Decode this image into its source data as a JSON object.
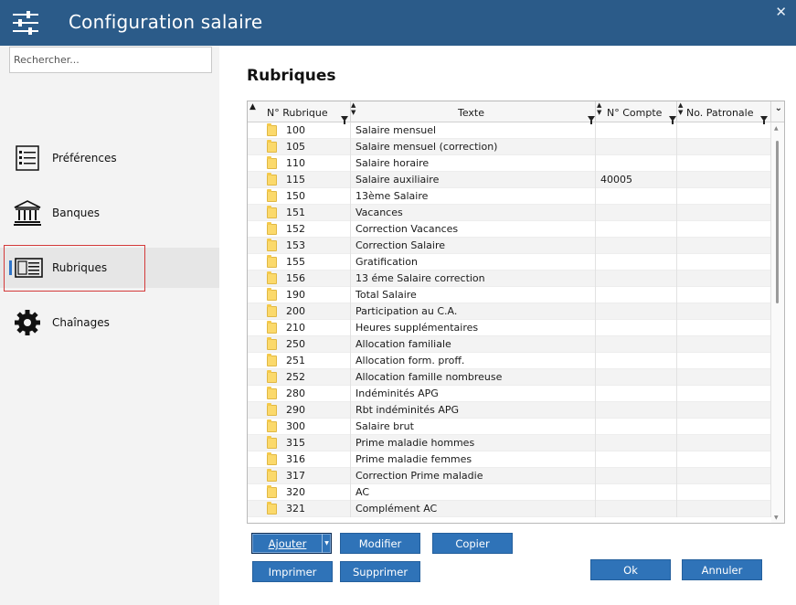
{
  "window": {
    "title": "Configuration salaire",
    "close_glyph": "✕"
  },
  "sidebar": {
    "search_placeholder": "Rechercher...",
    "items": [
      {
        "label": "Préférences",
        "icon": "preferences-list-icon"
      },
      {
        "label": "Banques",
        "icon": "bank-icon"
      },
      {
        "label": "Rubriques",
        "icon": "rubriques-panel-icon",
        "active": true
      },
      {
        "label": "Chaînages",
        "icon": "gear-icon"
      }
    ]
  },
  "main": {
    "title": "Rubriques",
    "columns": [
      "N° Rubrique",
      "Texte",
      "N° Compte",
      "No. Patronale"
    ],
    "rows": [
      {
        "num": "100",
        "texte": "Salaire mensuel",
        "compte": "",
        "patronale": ""
      },
      {
        "num": "105",
        "texte": "Salaire mensuel (correction)",
        "compte": "",
        "patronale": ""
      },
      {
        "num": "110",
        "texte": "Salaire horaire",
        "compte": "",
        "patronale": ""
      },
      {
        "num": "115",
        "texte": "Salaire auxiliaire",
        "compte": "40005",
        "patronale": ""
      },
      {
        "num": "150",
        "texte": "13ème Salaire",
        "compte": "",
        "patronale": ""
      },
      {
        "num": "151",
        "texte": "Vacances",
        "compte": "",
        "patronale": ""
      },
      {
        "num": "152",
        "texte": "Correction Vacances",
        "compte": "",
        "patronale": ""
      },
      {
        "num": "153",
        "texte": "Correction Salaire",
        "compte": "",
        "patronale": ""
      },
      {
        "num": "155",
        "texte": "Gratification",
        "compte": "",
        "patronale": ""
      },
      {
        "num": "156",
        "texte": "13 éme Salaire correction",
        "compte": "",
        "patronale": ""
      },
      {
        "num": "190",
        "texte": "Total Salaire",
        "compte": "",
        "patronale": ""
      },
      {
        "num": "200",
        "texte": "Participation au C.A.",
        "compte": "",
        "patronale": ""
      },
      {
        "num": "210",
        "texte": "Heures supplémentaires",
        "compte": "",
        "patronale": ""
      },
      {
        "num": "250",
        "texte": "Allocation familiale",
        "compte": "",
        "patronale": ""
      },
      {
        "num": "251",
        "texte": "Allocation form. proff.",
        "compte": "",
        "patronale": ""
      },
      {
        "num": "252",
        "texte": "Allocation famille nombreuse",
        "compte": "",
        "patronale": ""
      },
      {
        "num": "280",
        "texte": "Indéminités APG",
        "compte": "",
        "patronale": ""
      },
      {
        "num": "290",
        "texte": "Rbt indéminités APG",
        "compte": "",
        "patronale": ""
      },
      {
        "num": "300",
        "texte": "Salaire brut",
        "compte": "",
        "patronale": ""
      },
      {
        "num": "315",
        "texte": "Prime maladie hommes",
        "compte": "",
        "patronale": ""
      },
      {
        "num": "316",
        "texte": "Prime maladie femmes",
        "compte": "",
        "patronale": ""
      },
      {
        "num": "317",
        "texte": "Correction Prime maladie",
        "compte": "",
        "patronale": ""
      },
      {
        "num": "320",
        "texte": "AC",
        "compte": "",
        "patronale": ""
      },
      {
        "num": "321",
        "texte": "Complément AC",
        "compte": "",
        "patronale": ""
      }
    ]
  },
  "buttons": {
    "ajouter": "Ajouter",
    "modifier": "Modifier",
    "copier": "Copier",
    "imprimer": "Imprimer",
    "supprimer": "Supprimer",
    "ok": "Ok",
    "annuler": "Annuler"
  },
  "colors": {
    "titlebar": "#2b5b89",
    "button": "#2f73b8",
    "active_indicator": "#2e74c9",
    "highlight_box": "#d33a3a"
  }
}
